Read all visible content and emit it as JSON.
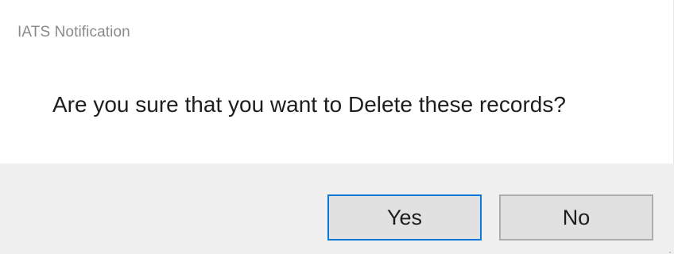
{
  "window": {
    "title": "IATS Notification"
  },
  "message": {
    "text": "Are you sure that you want to Delete these records?"
  },
  "buttons": {
    "yes_label": "Yes",
    "no_label": "No"
  },
  "colors": {
    "title_text": "#8a8a8a",
    "message_text": "#1e1e1e",
    "button_bar_bg": "#f0f0f0",
    "button_bg": "#e1e1e1",
    "default_button_border": "#0a78d7",
    "button_border": "#adadad"
  },
  "icons": {
    "resize_grip": "resize-grip-icon"
  }
}
